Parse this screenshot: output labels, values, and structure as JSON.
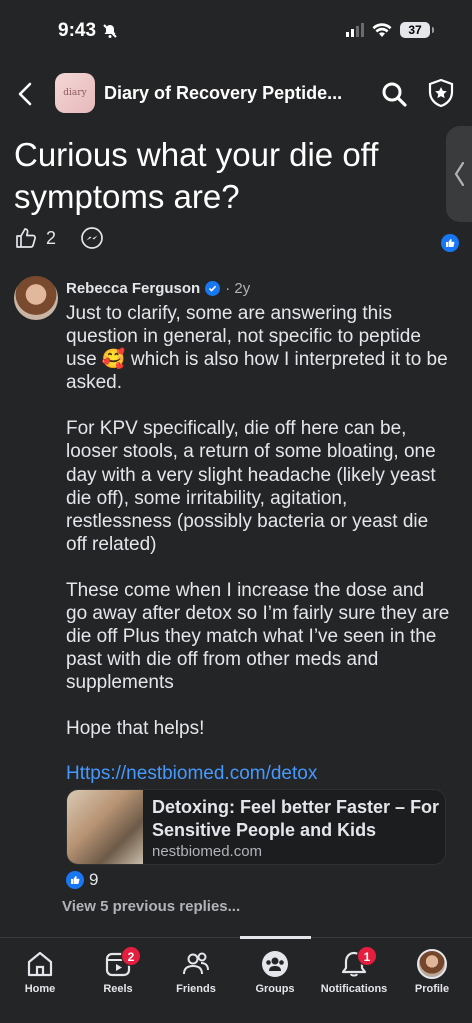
{
  "status_bar": {
    "time": "9:43",
    "battery": "37"
  },
  "header": {
    "group_name": "Diary of Recovery Peptide...",
    "group_thumb_text": "diary"
  },
  "post": {
    "title": "Curious what your die off symptoms are?",
    "like_count": "2"
  },
  "comment": {
    "author": "Rebecca Ferguson",
    "age": "· 2y",
    "paragraphs": [
      "Just to clarify, some are answering this question in general, not specific to peptide use 🥰 which is also how I interpreted it to be asked.",
      "For KPV specifically, die off here can be, looser stools, a return of some bloating, one day with a very slight headache (likely yeast die off), some irritability, agitation, restlessness  (possibly bacteria or yeast die off related)",
      "These come when I increase the dose and go away after detox so I’m fairly sure they are die off    Plus they match what I’ve seen in the past with die off from other meds and supplements",
      "Hope that helps!"
    ],
    "link": "Https://nestbiomed.com/detox",
    "link_card": {
      "title": "Detoxing: Feel better Faster – For Sensitive People and Kids",
      "domain": "nestbiomed.com"
    },
    "like_count": "9",
    "previous_replies": "View 5 previous replies..."
  },
  "tabbar": {
    "tabs": [
      {
        "label": "Home"
      },
      {
        "label": "Reels",
        "badge": "2"
      },
      {
        "label": "Friends"
      },
      {
        "label": "Groups"
      },
      {
        "label": "Notifications",
        "badge": "1"
      },
      {
        "label": "Profile"
      }
    ]
  },
  "colors": {
    "background": "#242526",
    "accent": "#1877f2",
    "link": "#4599ff",
    "badge": "#e41e3f"
  }
}
